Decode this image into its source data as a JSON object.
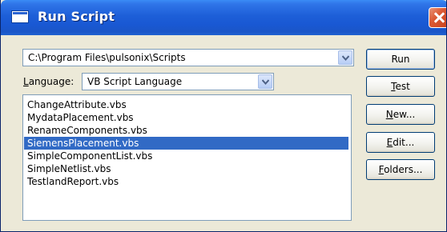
{
  "window": {
    "title": "Run Script",
    "icon": "app-window-icon",
    "close_icon": "close-icon"
  },
  "path_combo": {
    "value": "C:\\Program Files\\pulsonix\\Scripts",
    "icon": "chevron-down-icon"
  },
  "language": {
    "label_mnemonic": "L",
    "label_rest": "anguage:",
    "value": "VB Script Language",
    "icon": "chevron-down-icon"
  },
  "scripts": [
    "ChangeAttribute.vbs",
    "MydataPlacement.vbs",
    "RenameComponents.vbs",
    "SiemensPlacement.vbs",
    "SimpleComponentList.vbs",
    "SimpleNetlist.vbs",
    "TestlandReport.vbs"
  ],
  "selected_script": "SiemensPlacement.vbs",
  "buttons": {
    "run": {
      "label": "Run"
    },
    "test": {
      "mnemonic": "T",
      "rest": "est"
    },
    "new": {
      "mnemonic": "N",
      "rest": "ew..."
    },
    "edit": {
      "mnemonic": "E",
      "rest": "dit..."
    },
    "folders": {
      "mnemonic": "F",
      "rest": "olders..."
    }
  },
  "colors": {
    "title_bar": "#1d5fd8",
    "selection": "#316ac5",
    "dialog_bg": "#ece9d8"
  }
}
